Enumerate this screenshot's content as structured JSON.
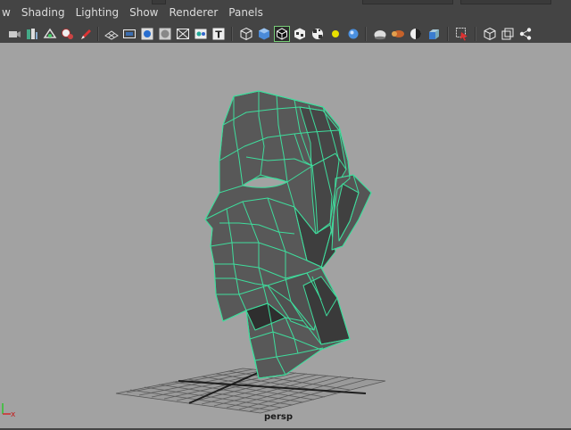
{
  "menubar": {
    "items": [
      "w",
      "Shading",
      "Lighting",
      "Show",
      "Renderer",
      "Panels"
    ]
  },
  "toolbar": {
    "icons": [
      "camera-attributes-icon",
      "camera-select-icon",
      "bookmark-icon",
      "image-plane-icon",
      "2d-pan-zoom-icon",
      "grease-pencil-icon",
      "grid-toggle-icon",
      "film-gate-icon",
      "resolution-gate-icon",
      "gate-mask-icon",
      "field-chart-icon",
      "safe-action-icon",
      "safe-title-icon",
      "wireframe-icon",
      "smooth-shade-icon",
      "wireframe-on-shaded-icon",
      "textured-icon",
      "use-all-lights-icon",
      "shadows-icon",
      "ambient-occlusion-icon",
      "motion-blur-icon",
      "multisample-icon",
      "depth-of-field-icon",
      "isolate-select-icon",
      "xray-icon",
      "xray-joints-icon",
      "xray-components-icon"
    ]
  },
  "viewport": {
    "camera_label": "persp",
    "axis_x_label": "x",
    "background": "#a2a2a2",
    "wire_color": "#3fdc9c",
    "mesh_color": "#585858"
  }
}
